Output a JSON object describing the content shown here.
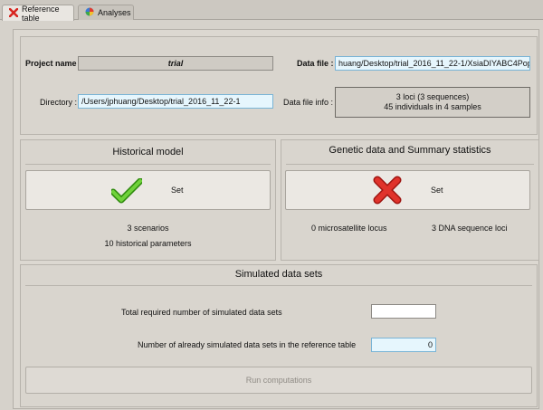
{
  "tabs": [
    {
      "label": "Reference table",
      "icon": "red-x-icon",
      "active": true
    },
    {
      "label": "Analyses",
      "icon": "colorful-analysis-icon",
      "active": false
    }
  ],
  "project": {
    "name_label": "Project name :",
    "name_value": "trial",
    "directory_label": "Directory :",
    "directory_value": "/Users/jphuang/Desktop/trial_2016_11_22-1",
    "datafile_label": "Data file :",
    "datafile_value": "huang/Desktop/trial_2016_11_22-1/XsiaDIYABC4Pops.txt",
    "datafile_info_label": "Data file info :",
    "datafile_info_line1": "3 loci (3 sequences)",
    "datafile_info_line2": "45 individuals in 4 samples"
  },
  "historical": {
    "title": "Historical model",
    "set_label": "Set",
    "set_icon": "green-check-icon",
    "scenarios": "3 scenarios",
    "parameters": "10 historical parameters"
  },
  "genetic": {
    "title": "Genetic data and Summary statistics",
    "set_label": "Set",
    "set_icon": "red-x-icon",
    "microsat": "0 microsatellite locus",
    "dna": "3 DNA sequence loci"
  },
  "simulated": {
    "title": "Simulated data sets",
    "total_label": "Total required number of simulated data sets",
    "total_value": "",
    "already_label": "Number of already simulated data sets in the reference table",
    "already_value": "0",
    "run_label": "Run computations"
  },
  "colors": {
    "check_green": "#4caf1a",
    "x_red": "#d8251f",
    "field_blue": "#e6f6fd"
  }
}
